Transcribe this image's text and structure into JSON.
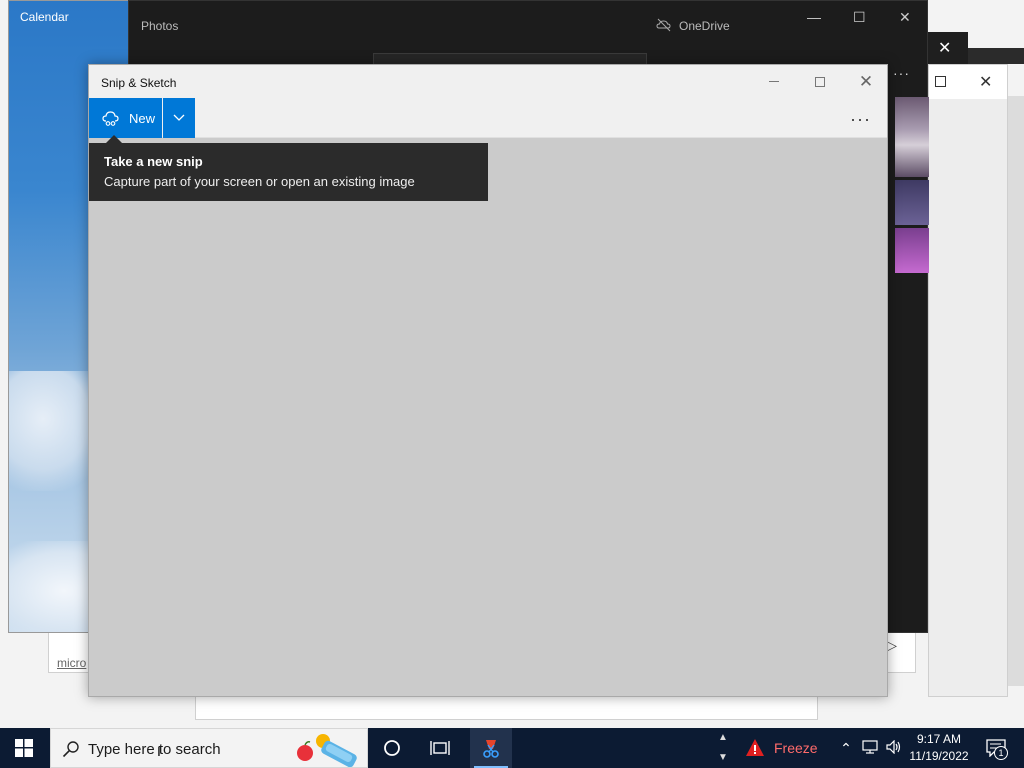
{
  "background_windows": {
    "calendar": {
      "title": "Calendar"
    },
    "photos": {
      "title": "Photos",
      "onedrive_label": "OneDrive"
    },
    "back_window": {
      "partial_text": "micro"
    }
  },
  "snip_window": {
    "title": "Snip & Sketch",
    "new_button_label": "New",
    "more_menu_label": "...",
    "tooltip": {
      "heading": "Take a new snip",
      "body": "Capture part of your screen or open an existing image"
    }
  },
  "taskbar": {
    "search_placeholder": "Type here to search",
    "freeze_label": "Freeze",
    "clock_time": "9:17 AM",
    "clock_date": "11/19/2022",
    "notification_count": "1"
  },
  "colors": {
    "accent": "#0078d7",
    "taskbar": "#0c1b33",
    "tooltip": "#2b2b2b",
    "canvas": "#cbcbcb",
    "freeze": "#ff6b6b"
  }
}
